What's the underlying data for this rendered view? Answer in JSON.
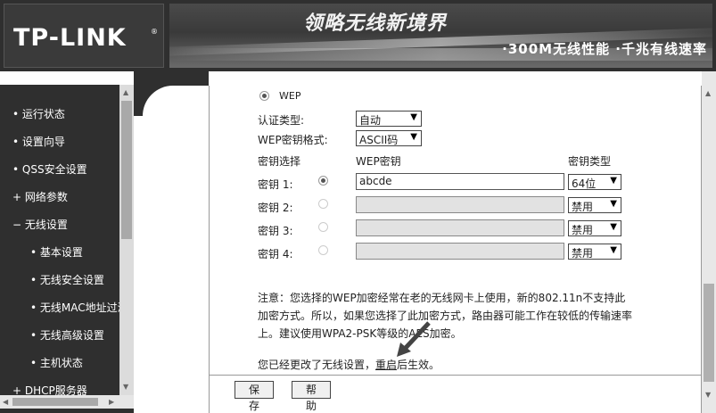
{
  "header": {
    "logo": "TP-LINK",
    "logo_mark": "®",
    "slogan": "领略无线新境界",
    "tagline": "·300M无线性能 ·千兆有线速率"
  },
  "menu": [
    {
      "label": "运行状态",
      "bullet": "•"
    },
    {
      "label": "设置向导",
      "bullet": "•"
    },
    {
      "label": "QSS安全设置",
      "bullet": "•"
    },
    {
      "label": "网络参数",
      "bullet": "+"
    },
    {
      "label": "无线设置",
      "bullet": "−"
    },
    {
      "label": "基本设置",
      "bullet": "•"
    },
    {
      "label": "无线安全设置",
      "bullet": "•"
    },
    {
      "label": "无线MAC地址过滤",
      "bullet": "•"
    },
    {
      "label": "无线高级设置",
      "bullet": "•"
    },
    {
      "label": "主机状态",
      "bullet": "•"
    },
    {
      "label": "DHCP服务器",
      "bullet": "+"
    }
  ],
  "form": {
    "wep_label": "WEP",
    "auth_type_label": "认证类型:",
    "auth_type_value": "自动",
    "key_format_label": "WEP密钥格式:",
    "key_format_value": "ASCII码",
    "col_key_select": "密钥选择",
    "col_wep_key": "WEP密钥",
    "col_key_type": "密钥类型",
    "keys": [
      {
        "label": "密钥 1:",
        "value": "abcde",
        "type": "64位",
        "selected": true
      },
      {
        "label": "密钥 2:",
        "value": "",
        "type": "禁用",
        "selected": false
      },
      {
        "label": "密钥 3:",
        "value": "",
        "type": "禁用",
        "selected": false
      },
      {
        "label": "密钥 4:",
        "value": "",
        "type": "禁用",
        "selected": false
      }
    ],
    "note": "注意：您选择的WEP加密经常在老的无线网卡上使用，新的802.11n不支持此加密方式。所以，如果您选择了此加密方式，路由器可能工作在较低的传输速率上。建议使用WPA2-PSK等级的AES加密。",
    "restart_prefix": "您已经更改了无线设置，",
    "restart_link": "重启",
    "restart_suffix": "后生效。",
    "save_label": "保 存",
    "help_label": "帮 助"
  },
  "icons": {
    "caret": "▼",
    "scroll_up": "▲",
    "scroll_down": "▼",
    "scroll_left": "◀",
    "scroll_right": "▶"
  }
}
